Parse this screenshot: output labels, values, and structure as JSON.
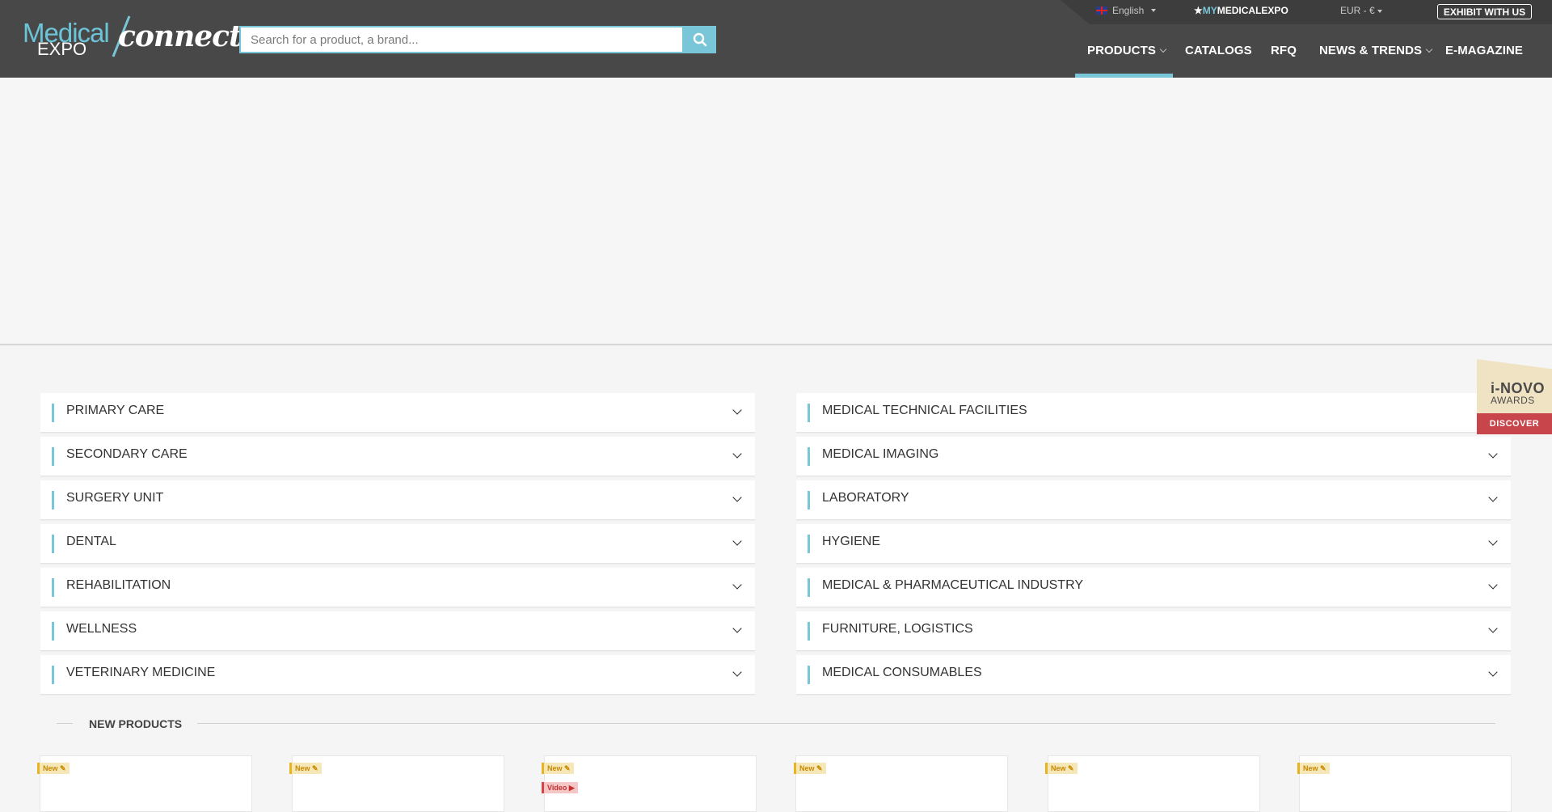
{
  "header": {
    "logo": {
      "medical": "Medical",
      "expo": "EXPO",
      "connect": "connect"
    },
    "search": {
      "placeholder": "Search for a product, a brand..."
    },
    "topbar": {
      "language": "English",
      "my_prefix": "MY",
      "my_suffix": "MEDICALEXPO",
      "currency": "EUR - €",
      "exhibit": "EXHIBIT WITH US"
    },
    "nav": {
      "products": "PRODUCTS",
      "catalogs": "CATALOGS",
      "rfq": "RFQ",
      "news": "NEWS & TRENDS",
      "emagazine": "E-MAGAZINE"
    }
  },
  "categories": {
    "left": [
      "PRIMARY CARE",
      "SECONDARY CARE",
      "SURGERY UNIT",
      "DENTAL",
      "REHABILITATION",
      "WELLNESS",
      "VETERINARY MEDICINE"
    ],
    "right": [
      "MEDICAL TECHNICAL FACILITIES",
      "MEDICAL IMAGING",
      "LABORATORY",
      "HYGIENE",
      "MEDICAL & PHARMACEUTICAL INDUSTRY",
      "FURNITURE, LOGISTICS",
      "MEDICAL CONSUMABLES"
    ]
  },
  "inovo": {
    "title": "i-NOVO",
    "sub": "AWARDS",
    "button": "DISCOVER"
  },
  "new_products": {
    "title": "NEW PRODUCTS",
    "new_label": "New",
    "video_label": "Video"
  },
  "colors": {
    "accent": "#78c6d8",
    "header": "#484848",
    "new_tag": "#e8b322",
    "video_tag": "#d64545",
    "inovo": "#c7454b"
  }
}
